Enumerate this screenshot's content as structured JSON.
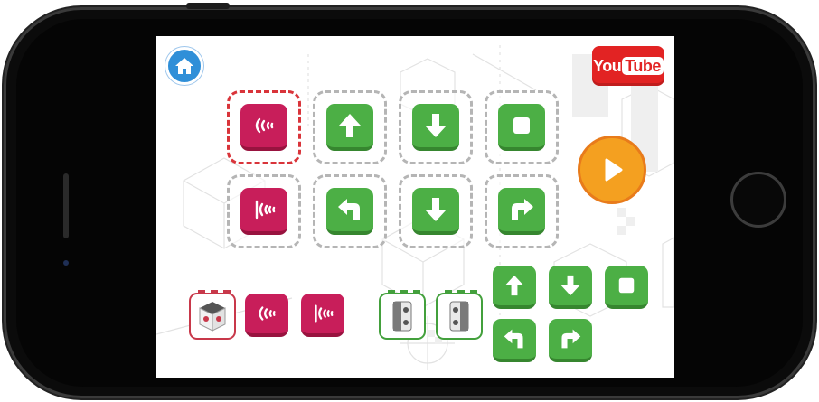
{
  "app": {
    "youtube": {
      "you": "You",
      "tube": "Tube"
    }
  },
  "colors": {
    "green": "#4caf45",
    "pink": "#c81e5a",
    "home_blue": "#2f8fd8",
    "play_orange": "#f4a020",
    "youtube_red": "#e22323",
    "selected_border": "#d9343a"
  },
  "program": {
    "rows": [
      {
        "slots": [
          {
            "icon": "sound-sensor-icon",
            "color": "pink",
            "selected": true
          },
          {
            "icon": "arrow-up-icon",
            "color": "green"
          },
          {
            "icon": "arrow-down-icon",
            "color": "green"
          },
          {
            "icon": "stop-icon",
            "color": "green"
          }
        ]
      },
      {
        "slots": [
          {
            "icon": "obstacle-sensor-icon",
            "color": "pink"
          },
          {
            "icon": "turn-left-icon",
            "color": "green"
          },
          {
            "icon": "arrow-down-icon",
            "color": "green"
          },
          {
            "icon": "turn-right-icon",
            "color": "green"
          }
        ]
      }
    ]
  },
  "palette": {
    "sensors": [
      "robot-head-icon",
      "sound-sensor-icon",
      "obstacle-sensor-icon"
    ],
    "motors": [
      "motor-block-icon",
      "motor-block-icon"
    ],
    "moves": [
      "arrow-up-icon",
      "arrow-down-icon",
      "stop-icon",
      "turn-left-icon",
      "turn-right-icon"
    ]
  }
}
